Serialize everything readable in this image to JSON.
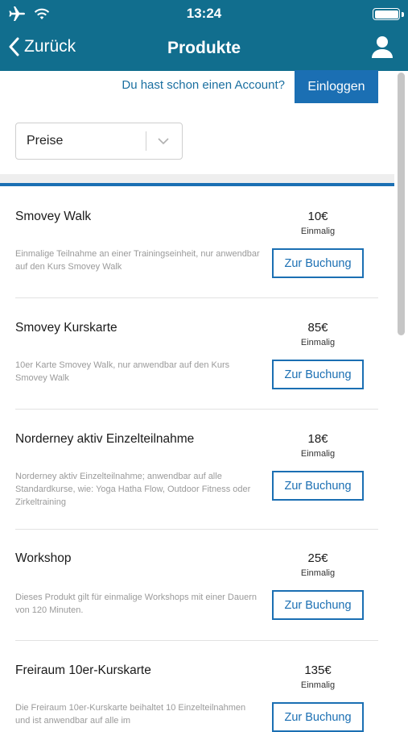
{
  "status_bar": {
    "time": "13:24"
  },
  "nav": {
    "back_label": "Zurück",
    "title": "Produkte"
  },
  "account": {
    "prompt": "Du hast schon einen Account?",
    "login_label": "Einloggen"
  },
  "filter": {
    "selected": "Preise"
  },
  "colors": {
    "header": "#116e8e",
    "accent": "#1b6fb3"
  },
  "products": [
    {
      "title": "Smovey Walk",
      "description": "Einmalige Teilnahme an einer Trainingseinheit, nur anwendbar auf den Kurs Smovey Walk",
      "price": "10€",
      "frequency": "Einmalig",
      "button": "Zur Buchung"
    },
    {
      "title": "Smovey Kurskarte",
      "description": "10er Karte Smovey Walk, nur anwendbar auf den Kurs Smovey Walk",
      "price": "85€",
      "frequency": "Einmalig",
      "button": "Zur Buchung"
    },
    {
      "title": "Norderney aktiv Einzelteilnahme",
      "description": "Norderney aktiv Einzelteilnahme; anwendbar auf alle Standardkurse, wie: Yoga Hatha Flow, Outdoor Fitness oder Zirkeltraining",
      "price": "18€",
      "frequency": "Einmalig",
      "button": "Zur Buchung"
    },
    {
      "title": "Workshop",
      "description": "Dieses Produkt gilt für einmalige Workshops mit einer Dauern von 120 Minuten.",
      "price": "25€",
      "frequency": "Einmalig",
      "button": "Zur Buchung"
    },
    {
      "title": "Freiraum 10er-Kurskarte",
      "description": "Die Freiraum 10er-Kurskarte beihaltet 10 Einzelteilnahmen und ist anwendbar auf alle im",
      "price": "135€",
      "frequency": "Einmalig",
      "button": "Zur Buchung"
    }
  ]
}
